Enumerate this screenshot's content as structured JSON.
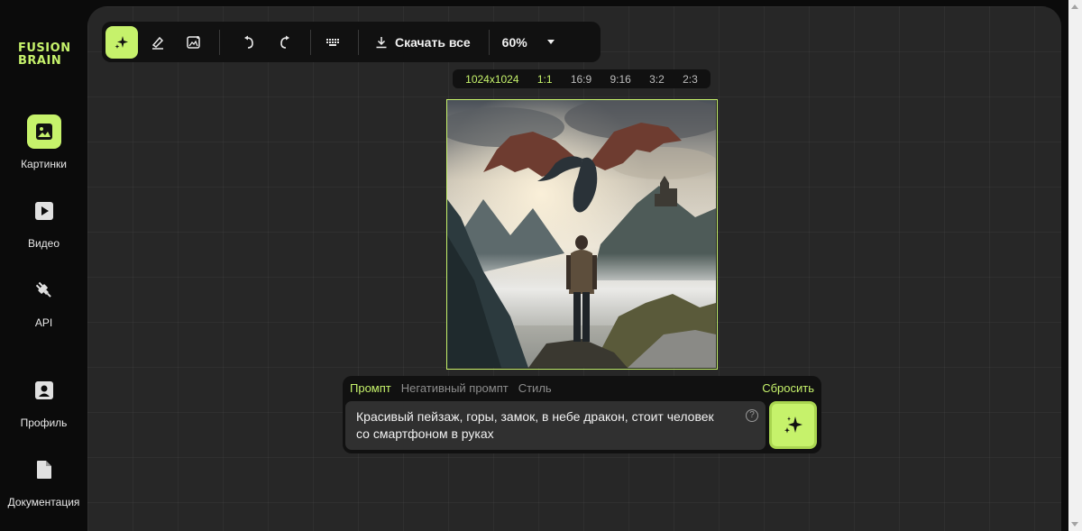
{
  "brand": {
    "line1": "FUSION",
    "line2": "BRAIN",
    "accent": "#c6f26b"
  },
  "sidebar": {
    "items": [
      {
        "label": "Картинки",
        "icon": "image-icon",
        "active": true
      },
      {
        "label": "Видео",
        "icon": "play-icon",
        "active": false
      },
      {
        "label": "API",
        "icon": "plug-icon",
        "active": false
      },
      {
        "label": "Профиль",
        "icon": "profile-icon",
        "active": false
      },
      {
        "label": "Документация",
        "icon": "document-icon",
        "active": false
      }
    ]
  },
  "toolbar": {
    "tools": [
      {
        "icon": "sparkle-icon",
        "active": true
      },
      {
        "icon": "eraser-icon",
        "active": false
      },
      {
        "icon": "image-edit-icon",
        "active": false
      },
      {
        "icon": "undo-icon",
        "active": false
      },
      {
        "icon": "redo-icon",
        "active": false
      },
      {
        "icon": "keyboard-icon",
        "active": false
      }
    ],
    "download_label": "Скачать все",
    "zoom": "60%"
  },
  "ratios": {
    "resolution": "1024x1024",
    "options": [
      "1:1",
      "16:9",
      "9:16",
      "3:2",
      "2:3"
    ],
    "selected": "1:1"
  },
  "prompt": {
    "tabs": [
      "Промпт",
      "Негативный промпт",
      "Стиль"
    ],
    "active_tab": "Промпт",
    "reset_label": "Сбросить",
    "line1": "Красивый пейзаж, горы, замок, в небе дракон, стоит человек",
    "line2": "со смартфоном в руках",
    "help": "?"
  }
}
